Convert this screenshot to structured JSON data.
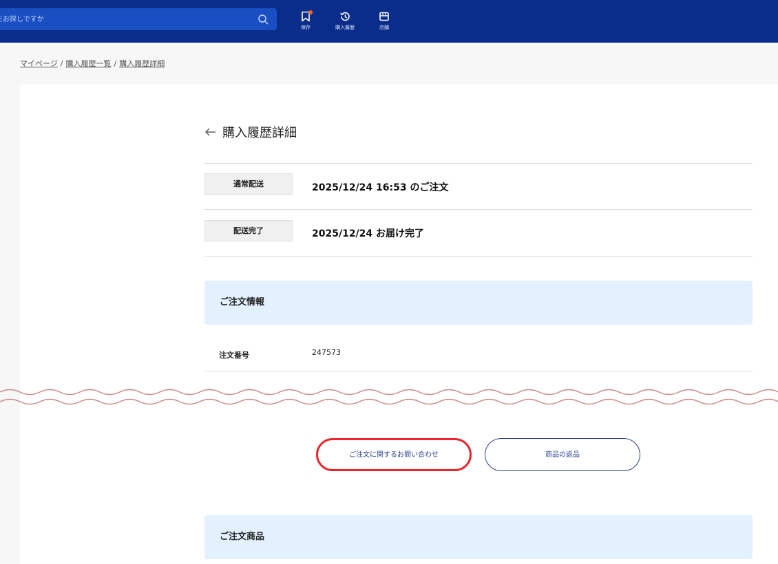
{
  "header": {
    "search_placeholder": "をお探しですか",
    "nav": [
      {
        "label": "保存",
        "icon": "bookmark-icon"
      },
      {
        "label": "購入履歴",
        "icon": "history-icon"
      },
      {
        "label": "店舗",
        "icon": "store-icon"
      }
    ],
    "colors": {
      "bar": "#0a2c8a",
      "search": "#1a4fc4",
      "badge": "#ff6a2a"
    }
  },
  "breadcrumb": [
    "マイページ",
    "購入履歴一覧",
    "購入履歴詳細"
  ],
  "page_title": "購入履歴詳細",
  "status_rows": [
    {
      "tag": "通常配送",
      "text": "2025/12/24 16:53 のご注文"
    },
    {
      "tag": "配送完了",
      "text": "2025/12/24 お届け完了"
    }
  ],
  "order_info": {
    "heading": "ご注文情報",
    "fields": [
      {
        "label": "注文番号",
        "value": "247573"
      }
    ]
  },
  "buttons": {
    "inquiry": "ご注文に関するお問い合わせ",
    "return": "商品の返品"
  },
  "order_items": {
    "heading": "ご注文商品"
  },
  "accent_colors": {
    "button_border": "#2a3f8f",
    "highlight": "#e8262a",
    "section_bg": "#e3f0fe"
  }
}
